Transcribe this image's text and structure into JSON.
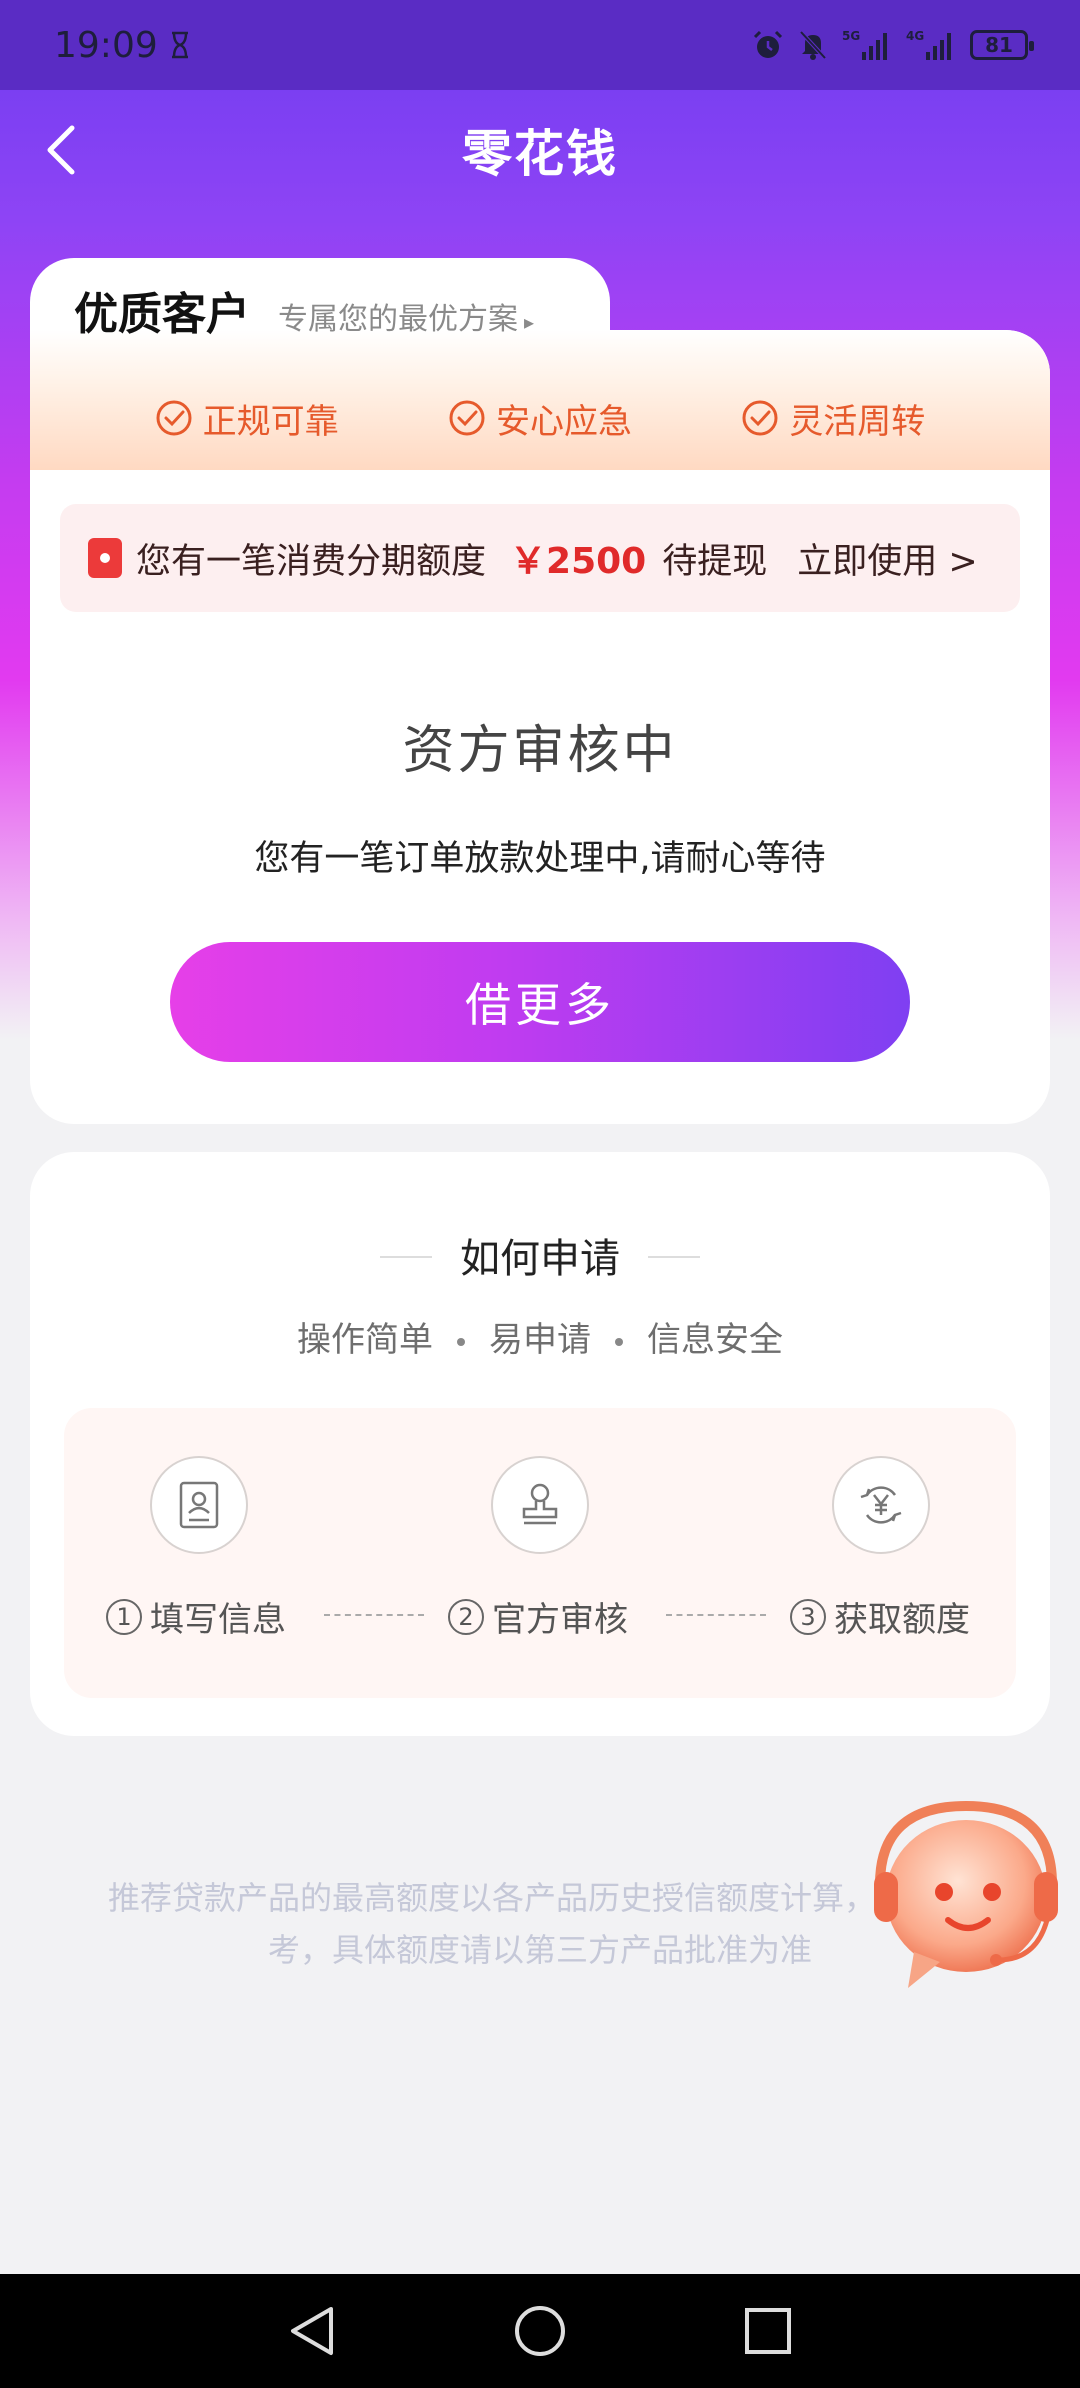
{
  "status_bar": {
    "time": "19:09",
    "battery": "81",
    "icons": [
      "hourglass-icon",
      "alarm-icon",
      "mute-icon",
      "signal-5g-icon",
      "signal-4g-icon",
      "battery-icon"
    ]
  },
  "nav": {
    "title": "零花钱",
    "back_icon": "chevron-left-icon"
  },
  "card1": {
    "tab_title": "优质客户",
    "tab_subtitle": "专属您的最优方案",
    "tab_subtitle_arrow": "▸",
    "features": [
      "正规可靠",
      "安心应急",
      "灵活周转"
    ],
    "promo": {
      "text": "您有一笔消费分期额度",
      "amount": "￥2500",
      "tail": "待提现",
      "action": "立即使用 >"
    },
    "review_title": "资方审核中",
    "review_desc": "您有一笔订单放款处理中,请耐心等待",
    "borrow_button": "借更多"
  },
  "card2": {
    "title": "如何申请",
    "subtitle_items": [
      "操作简单",
      "易申请",
      "信息安全"
    ],
    "steps": [
      {
        "num": "1",
        "label": "填写信息",
        "icon": "form-icon"
      },
      {
        "num": "2",
        "label": "官方审核",
        "icon": "stamp-icon"
      },
      {
        "num": "3",
        "label": "获取额度",
        "icon": "yuan-icon"
      }
    ]
  },
  "disclaimer": "推荐贷款产品的最高额度以各产品历史授信额度计算，仅供参考，具体额度请以第三方产品批准为准",
  "colors": {
    "brand_purple": "#7b3ff2",
    "brand_magenta": "#e63fe8",
    "feature_orange": "#e65a2c",
    "promo_red": "#e02a2a"
  }
}
